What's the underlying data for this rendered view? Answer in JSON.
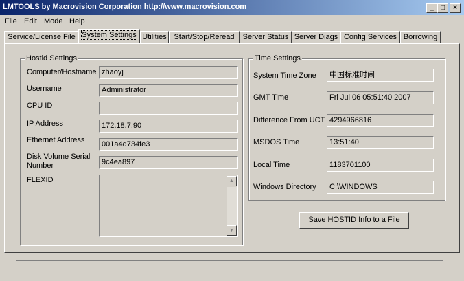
{
  "window": {
    "title": "LMTOOLS by Macrovision Corporation http://www.macrovision.com"
  },
  "title_buttons": {
    "minimize": "_",
    "maximize": "□",
    "close": "×"
  },
  "menu": [
    "File",
    "Edit",
    "Mode",
    "Help"
  ],
  "tabs": [
    "Service/License File",
    "System Settings",
    "Utilities",
    "Start/Stop/Reread",
    "Server Status",
    "Server Diags",
    "Config Services",
    "Borrowing"
  ],
  "active_tab": "System Settings",
  "hostid": {
    "title": "Hostid Settings",
    "computer_label": "Computer/Hostname",
    "computer_value": "zhaoyj",
    "username_label": "Username",
    "username_value": "Administrator",
    "cpuid_label": "CPU ID",
    "cpuid_value": "",
    "ip_label": "IP Address",
    "ip_value": "172.18.7.90",
    "ethernet_label": "Ethernet Address",
    "ethernet_value": "001a4d734fe3",
    "disk_label_1": "Disk Volume Serial",
    "disk_label_2": "Number",
    "disk_value": "9c4ea897",
    "flexid_label": "FLEXID"
  },
  "time": {
    "title": "Time Settings",
    "tz_label": "System Time Zone",
    "tz_value": "中国标准时间",
    "gmt_label": "GMT Time",
    "gmt_value": "Fri Jul 06 05:51:40 2007",
    "diff_label": "Difference From UCT",
    "diff_value": "4294966816",
    "msdos_label": "MSDOS Time",
    "msdos_value": "13:51:40",
    "local_label": "Local Time",
    "local_value": "1183701100",
    "windir_label": "Windows Directory",
    "windir_value": "C:\\WINDOWS"
  },
  "save_button": "Save HOSTID Info to a File",
  "scroll": {
    "up": "▲",
    "down": "▼"
  }
}
